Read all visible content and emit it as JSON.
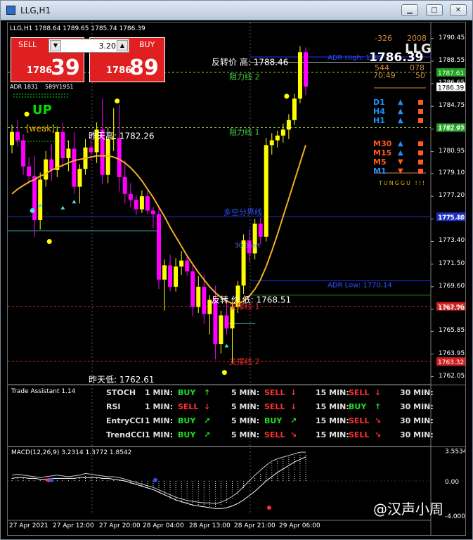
{
  "window": {
    "title": "LLG,H1"
  },
  "header": {
    "ohlc": "LLG,H1  1788.64 1789.65 1785.74 1786.39"
  },
  "trade": {
    "sell_label": "SELL",
    "buy_label": "BUY",
    "lot": "3.20",
    "sell_small": "1786",
    "sell_big": "39",
    "buy_small": "1786",
    "buy_big": "89"
  },
  "info": {
    "adr": "ADR 1831",
    "adr_cut": "589Y1951",
    "trend": "UP",
    "weak": "[weak]",
    "top_left": "-326",
    "top_right": "2008",
    "symbol": "LLG",
    "price": "1786.39",
    "row2_left": "544",
    "row2_right": "078",
    "row3_left": "70:49",
    "row3_right": "50",
    "footer": "TUNGGU !!!",
    "colors": {
      "up": "#1e90ff",
      "down": "#ff5a1e",
      "square": "#ff5a1e"
    }
  },
  "timeframes": [
    {
      "label": "D1",
      "color": "#1e90ff",
      "dir": "up"
    },
    {
      "label": "H4",
      "color": "#1e90ff",
      "dir": "up"
    },
    {
      "label": "H1",
      "color": "#1e90ff",
      "dir": "up"
    },
    {
      "label": "M30",
      "color": "#ff5a1e",
      "dir": "up"
    },
    {
      "label": "M15",
      "color": "#ff5a1e",
      "dir": "up"
    },
    {
      "label": "M5",
      "color": "#ff5a1e",
      "dir": "down"
    },
    {
      "label": "M1",
      "color": "#1e90ff",
      "dir": "down"
    }
  ],
  "annotations": {
    "reversal_high": "反转价 高: 1788.46",
    "resistance2": "阻力线 2",
    "resistance1": "阻力线 1",
    "yesterday_high": "昨天高: 1782.26",
    "long_short": "多空分界线",
    "start": "30 Start",
    "adr_high": "ADR High: 1789",
    "adr_low": "ADR Low: 1770.14",
    "reversal_low": "反转 价 低: 1768.51",
    "support1": "支撑线 1",
    "support2": "支撑线 2",
    "yesterday_low": "昨天低: 1762.61"
  },
  "chart_data": {
    "type": "candlestick",
    "symbol": "LLG",
    "timeframe": "H1",
    "ylim": [
      1761.5,
      1791.5
    ],
    "y_ticks": [
      1790.45,
      1788.55,
      1786.65,
      1784.75,
      1782.85,
      1780.95,
      1779.1,
      1777.2,
      1775.3,
      1773.4,
      1771.5,
      1769.6,
      1767.7,
      1765.85,
      1763.95,
      1762.05
    ],
    "price_tags": [
      {
        "value": "1787.61",
        "color": "#1fa01f"
      },
      {
        "value": "1786.39",
        "color": "#ffffff"
      },
      {
        "value": "1782.97",
        "color": "#1fa01f"
      },
      {
        "value": "1775.48",
        "color": "#2030c8"
      },
      {
        "value": "1767.96",
        "color": "#d02020"
      },
      {
        "value": "1763.32",
        "color": "#d02020"
      }
    ],
    "x_ticks": [
      "27 Apr 2021",
      "27 Apr 12:00",
      "27 Apr 20:00",
      "28 Apr 04:00",
      "28 Apr 13:00",
      "28 Apr 21:00",
      "29 Apr 06:00"
    ],
    "levels": {
      "adr_high": 1788.9,
      "adr_low": 1770.14,
      "reversal_high": 1788.46,
      "reversal_low": 1768.51,
      "yesterday_high": 1782.26,
      "yesterday_low": 1762.61,
      "long_short": 1775.48,
      "resistance1": 1782.97,
      "resistance2": 1787.61,
      "support1": 1767.96,
      "support2": 1763.32
    },
    "candles": [
      [
        1781.5,
        1783.2,
        1780.8,
        1782.6
      ],
      [
        1782.6,
        1783.6,
        1781.4,
        1781.9
      ],
      [
        1781.9,
        1782.4,
        1779.0,
        1779.7
      ],
      [
        1779.7,
        1780.5,
        1778.2,
        1778.9
      ],
      [
        1778.9,
        1780.6,
        1773.8,
        1775.2
      ],
      [
        1775.2,
        1779.2,
        1774.4,
        1778.6
      ],
      [
        1778.6,
        1781.0,
        1778.0,
        1780.3
      ],
      [
        1780.3,
        1781.6,
        1778.5,
        1779.4
      ],
      [
        1779.4,
        1783.1,
        1778.8,
        1782.6
      ],
      [
        1782.6,
        1783.4,
        1779.6,
        1780.4
      ],
      [
        1780.4,
        1781.9,
        1779.3,
        1781.2
      ],
      [
        1781.2,
        1782.6,
        1777.4,
        1778.0
      ],
      [
        1778.0,
        1779.9,
        1776.6,
        1779.5
      ],
      [
        1779.5,
        1782.0,
        1779.0,
        1781.3
      ],
      [
        1781.3,
        1782.5,
        1780.2,
        1780.9
      ],
      [
        1780.9,
        1783.4,
        1780.0,
        1782.8
      ],
      [
        1782.8,
        1785.4,
        1778.2,
        1779.0
      ],
      [
        1779.0,
        1783.0,
        1778.3,
        1782.0
      ],
      [
        1782.0,
        1784.6,
        1781.0,
        1782.1
      ],
      [
        1782.1,
        1784.9,
        1777.6,
        1778.8
      ],
      [
        1778.8,
        1780.2,
        1776.6,
        1777.4
      ],
      [
        1777.4,
        1778.3,
        1776.3,
        1776.9
      ],
      [
        1776.9,
        1777.3,
        1775.6,
        1776.1
      ],
      [
        1776.1,
        1777.7,
        1775.8,
        1777.2
      ],
      [
        1777.2,
        1777.7,
        1775.7,
        1776.0
      ],
      [
        1776.0,
        1776.3,
        1774.5,
        1775.7
      ],
      [
        1775.7,
        1776.2,
        1769.4,
        1770.2
      ],
      [
        1770.2,
        1771.9,
        1767.6,
        1771.4
      ],
      [
        1771.4,
        1772.3,
        1769.2,
        1769.6
      ],
      [
        1769.6,
        1772.0,
        1769.2,
        1771.3
      ],
      [
        1771.3,
        1772.6,
        1770.6,
        1771.8
      ],
      [
        1771.8,
        1772.2,
        1770.5,
        1770.9
      ],
      [
        1770.9,
        1771.4,
        1767.1,
        1767.9
      ],
      [
        1767.9,
        1770.5,
        1767.4,
        1769.6
      ],
      [
        1769.6,
        1770.6,
        1766.5,
        1767.3
      ],
      [
        1767.3,
        1768.9,
        1765.6,
        1768.5
      ],
      [
        1768.5,
        1769.7,
        1763.5,
        1764.8
      ],
      [
        1764.8,
        1767.6,
        1764.0,
        1767.2
      ],
      [
        1767.2,
        1768.6,
        1765.6,
        1766.1
      ],
      [
        1766.1,
        1768.3,
        1763.2,
        1767.9
      ],
      [
        1767.9,
        1770.1,
        1767.4,
        1769.7
      ],
      [
        1769.7,
        1774.0,
        1769.0,
        1773.5
      ],
      [
        1773.5,
        1774.4,
        1771.7,
        1772.4
      ],
      [
        1772.4,
        1775.3,
        1771.9,
        1774.9
      ],
      [
        1774.9,
        1775.4,
        1773.2,
        1773.8
      ],
      [
        1773.8,
        1782.1,
        1773.4,
        1781.5
      ],
      [
        1781.5,
        1782.5,
        1780.7,
        1781.9
      ],
      [
        1781.9,
        1782.7,
        1781.3,
        1782.3
      ],
      [
        1782.3,
        1783.3,
        1781.7,
        1782.8
      ],
      [
        1782.8,
        1784.1,
        1782.0,
        1783.6
      ],
      [
        1783.6,
        1785.8,
        1783.2,
        1785.4
      ],
      [
        1785.4,
        1789.8,
        1785.0,
        1789.3
      ],
      [
        1789.3,
        1789.7,
        1785.7,
        1786.4
      ]
    ],
    "ma": [
      1777.4,
      1777.8,
      1778.1,
      1778.4,
      1778.6,
      1778.9,
      1779.1,
      1779.4,
      1779.6,
      1779.8,
      1780.0,
      1780.2,
      1780.3,
      1780.4,
      1780.5,
      1780.6,
      1780.6,
      1780.6,
      1780.5,
      1780.3,
      1780.0,
      1779.6,
      1779.1,
      1778.5,
      1777.8,
      1777.1,
      1776.3,
      1775.5,
      1774.6,
      1773.8,
      1773.0,
      1772.2,
      1771.5,
      1770.8,
      1770.2,
      1769.6,
      1769.1,
      1768.7,
      1768.4,
      1768.2,
      1768.2,
      1768.4,
      1768.8,
      1769.4,
      1770.2,
      1771.3,
      1772.6,
      1774.0,
      1775.5,
      1777.0,
      1778.5,
      1780.0,
      1781.5
    ],
    "assistant": {
      "title": "Trade Assistant 1.14",
      "rows": [
        {
          "name": "STOCH",
          "cells": [
            [
              "1 MIN:",
              "BUY",
              "up"
            ],
            [
              "5 MIN:",
              "SELL",
              "down"
            ],
            [
              "15 MIN:",
              "SELL",
              "down"
            ],
            [
              "30 MIN:",
              "",
              ""
            ]
          ]
        },
        {
          "name": "RSI",
          "cells": [
            [
              "1 MIN:",
              "SELL",
              "down"
            ],
            [
              "5 MIN:",
              "SELL",
              "down"
            ],
            [
              "15 MIN:",
              "BUY",
              "up"
            ],
            [
              "30 MIN:",
              "",
              ""
            ]
          ]
        },
        {
          "name": "EntryCCI",
          "cells": [
            [
              "1 MIN:",
              "BUY",
              "upright"
            ],
            [
              "5 MIN:",
              "BUY",
              "upright"
            ],
            [
              "15 MIN:",
              "SELL",
              "downright"
            ],
            [
              "30 MIN:",
              "",
              ""
            ]
          ]
        },
        {
          "name": "TrendCCI",
          "cells": [
            [
              "1 MIN:",
              "BUY",
              "upright"
            ],
            [
              "5 MIN:",
              "SELL",
              "downright"
            ],
            [
              "15 MIN:",
              "SELL",
              "downright"
            ],
            [
              "30 MIN:",
              "",
              ""
            ]
          ]
        }
      ]
    },
    "macd": {
      "title": "MACD(12,26,9) 3.2314 1.3772 1.8542",
      "y_ticks": [
        "3.5534",
        "0.00",
        "-4.0004"
      ],
      "ylim": [
        -4.4,
        4.0
      ],
      "hist": [
        0.4,
        0.5,
        0.4,
        0.3,
        0.2,
        0.1,
        0.2,
        0.3,
        0.4,
        0.3,
        0.2,
        0.3,
        0.4,
        0.6,
        0.5,
        0.4,
        0.3,
        0.2,
        0.2,
        0.1,
        -0.1,
        -0.3,
        -0.5,
        -0.7,
        -0.9,
        -1.1,
        -1.4,
        -1.7,
        -2.0,
        -2.3,
        -2.5,
        -2.7,
        -2.8,
        -2.9,
        -3.0,
        -3.0,
        -3.1,
        -2.9,
        -2.6,
        -2.2,
        -1.7,
        -1.0,
        -0.3,
        0.4,
        1.0,
        1.6,
        2.1,
        2.4,
        2.6,
        2.8,
        3.0,
        3.2,
        3.2
      ],
      "signal": [
        0.3,
        0.4,
        0.4,
        0.3,
        0.3,
        0.2,
        0.2,
        0.3,
        0.3,
        0.3,
        0.3,
        0.3,
        0.4,
        0.4,
        0.4,
        0.4,
        0.3,
        0.3,
        0.2,
        0.1,
        0.0,
        -0.2,
        -0.4,
        -0.6,
        -0.8,
        -1.0,
        -1.3,
        -1.6,
        -1.9,
        -2.2,
        -2.4,
        -2.6,
        -2.8,
        -2.9,
        -3.0,
        -3.1,
        -3.2,
        -3.2,
        -3.1,
        -2.9,
        -2.6,
        -2.2,
        -1.7,
        -1.2,
        -0.6,
        0.0,
        0.5,
        1.0,
        1.4,
        1.8,
        2.2,
        2.5,
        2.8
      ]
    }
  },
  "watermark": "@汉声小周"
}
